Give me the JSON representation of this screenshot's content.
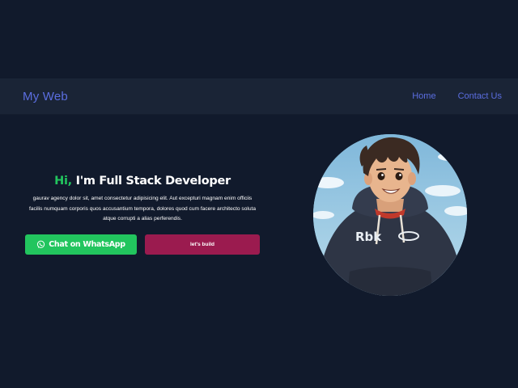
{
  "navbar": {
    "brand": "My Web",
    "links": [
      {
        "label": "Home"
      },
      {
        "label": "Contact Us"
      }
    ]
  },
  "hero": {
    "greeting": "Hi,",
    "headline": " I'm Full Stack Developer",
    "description": "gaurav agency dolor sit, amet consectetur adipisicing elit. Aut excepturi magnam enim officiis facilis numquam corporis quos accusantium tempora, dolores quod cum facere architecto soluta atque corrupti a alias perferendis."
  },
  "buttons": {
    "whatsapp": {
      "label": "Chat on WhatsApp",
      "icon": "whatsapp-icon",
      "color": "#22c55e"
    },
    "build": {
      "label": "let's build",
      "color": "#9b1b4f"
    }
  },
  "avatar": {
    "hoodie_text": "Rbk",
    "icon": "anime-avatar"
  },
  "colors": {
    "background": "#111a2c",
    "navbar": "#1a2436",
    "accent": "#5b6ee0",
    "green": "#22c55e"
  }
}
